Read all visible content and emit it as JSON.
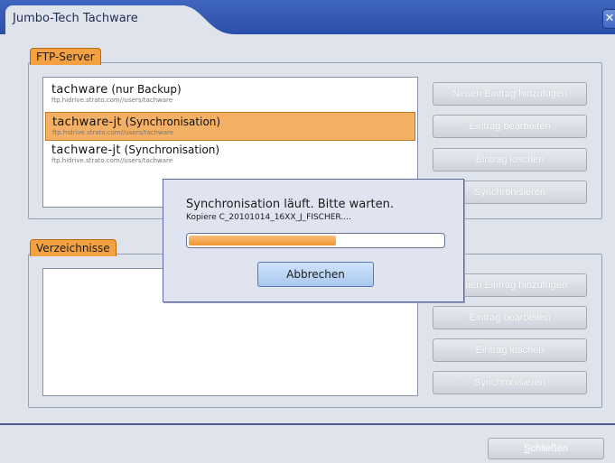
{
  "window": {
    "title": "Jumbo-Tech Tachware"
  },
  "ftp_group": {
    "label": "FTP-Server",
    "items": [
      {
        "name": "tachware",
        "note": "(nur Backup)",
        "url": "ftp.hidrive.strato.com//users/tachware",
        "selected": false
      },
      {
        "name": "tachware-jt",
        "note": "(Synchronisation)",
        "url": "ftp.hidrive.strato.com//users/tachware",
        "selected": true
      },
      {
        "name": "tachware-jt",
        "note": "(Synchronisation)",
        "url": "ftp.hidrive.strato.com//users/tachware",
        "selected": false
      }
    ],
    "buttons": {
      "add": "Neuen Eintrag hinzufügen",
      "edit": "Eintrag bearbeiten",
      "delete": "Eintrag löschen",
      "sync": "Synchronisieren"
    }
  },
  "dir_group": {
    "label": "Verzeichnisse",
    "buttons": {
      "add": "Neuen Eintrag hinzufügen",
      "edit": "Eintrag bearbeiten",
      "delete": "Eintrag löschen",
      "sync": "Synchronisieren"
    }
  },
  "footer": {
    "close_label_prefix": "S",
    "close_label_rest": "chließen"
  },
  "progress_dialog": {
    "message": "Synchronisation läuft. Bitte warten.",
    "detail": "Kopiere C_20101014_16XX_J_FISCHER....",
    "progress": 0.58,
    "cancel_label": "Abbrechen"
  },
  "colors": {
    "titlebar": "#2a4fa8",
    "accent": "#f4a142",
    "selection": "#f4b064",
    "progress_fill": "#f09632"
  }
}
